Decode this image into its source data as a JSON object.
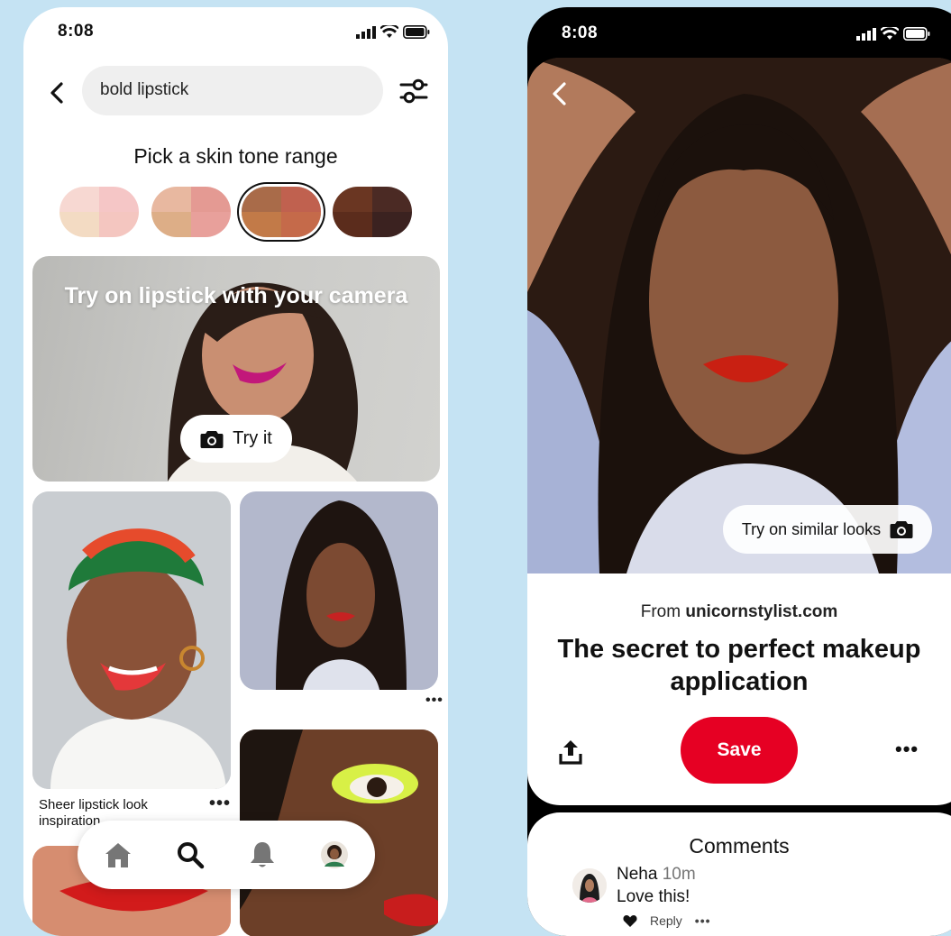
{
  "status": {
    "time": "8:08"
  },
  "search": {
    "query": "bold lipstick"
  },
  "skin_tone": {
    "title": "Pick a skin tone range",
    "swatches": [
      {
        "name": "light",
        "colors": [
          "#f7d8d2",
          "#f5c6c6",
          "#f3dbc3",
          "#f4c6c0"
        ],
        "selected": false
      },
      {
        "name": "medium-light",
        "colors": [
          "#e8b8a0",
          "#e49a93",
          "#ddae87",
          "#e8a09b"
        ],
        "selected": false
      },
      {
        "name": "medium-dark",
        "colors": [
          "#a96b49",
          "#c0614f",
          "#c27a48",
          "#c56a4a"
        ],
        "selected": true
      },
      {
        "name": "dark",
        "colors": [
          "#6a3622",
          "#4b2a24",
          "#5b2c1c",
          "#3b2220"
        ],
        "selected": false
      }
    ]
  },
  "camera_card": {
    "title": "Try on lipstick with your camera",
    "button": "Try it"
  },
  "pins": [
    {
      "caption": "Sheer lipstick look inspiration",
      "more": "•••"
    },
    {
      "caption": "",
      "more": "•••"
    }
  ],
  "nav": {
    "items": [
      "home",
      "search",
      "notifications",
      "profile"
    ],
    "active": "search"
  },
  "detail": {
    "similar_button": "Try on similar looks",
    "from_prefix": "From",
    "source": "unicornstylist.com",
    "title": "The secret to perfect makeup application",
    "save": "Save",
    "more": "•••"
  },
  "comments": {
    "title": "Comments",
    "items": [
      {
        "author": "Neha",
        "time": "10m",
        "text": "Love this!",
        "reply": "Reply",
        "more": "•••"
      }
    ]
  },
  "colors": {
    "accent": "#e60023",
    "background": "#c5e3f3"
  }
}
